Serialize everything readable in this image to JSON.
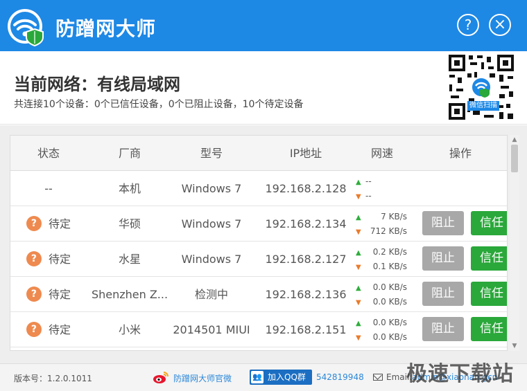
{
  "app": {
    "title": "防蹭网大师",
    "help_label": "?",
    "close_label": "×"
  },
  "header": {
    "network_title": "当前网络：有线局域网",
    "summary": "共连接10个设备：0个已信任设备，0个已阻止设备，10个待定设备",
    "qr_caption": "微信扫描"
  },
  "table": {
    "columns": [
      "状态",
      "厂商",
      "型号",
      "IP地址",
      "网速",
      "操作"
    ],
    "rows": [
      {
        "status": "--",
        "vendor": "本机",
        "model": "Windows 7",
        "ip": "192.168.2.128",
        "up": "--",
        "down": "--",
        "has_actions": false
      },
      {
        "status": "待定",
        "vendor": "华硕",
        "model": "Windows 7",
        "ip": "192.168.2.134",
        "up": "7 KB/s",
        "down": "712 KB/s",
        "has_actions": true
      },
      {
        "status": "待定",
        "vendor": "水星",
        "model": "Windows 7",
        "ip": "192.168.2.127",
        "up": "0.2 KB/s",
        "down": "0.1 KB/s",
        "has_actions": true
      },
      {
        "status": "待定",
        "vendor": "Shenzhen Z...",
        "model": "检测中",
        "ip": "192.168.2.136",
        "up": "0.0 KB/s",
        "down": "0.0 KB/s",
        "has_actions": true
      },
      {
        "status": "待定",
        "vendor": "小米",
        "model": "2014501 MIUI",
        "ip": "192.168.2.151",
        "up": "0.0 KB/s",
        "down": "0.0 KB/s",
        "has_actions": true
      }
    ],
    "block_label": "阻止",
    "trust_label": "信任",
    "status_icon": "exclamation-icon",
    "status_icon_glyph": "?"
  },
  "footer": {
    "version": "版本号：1.2.0.1011",
    "weibo_link": "防蹭网大师官微",
    "qq_button": "加入QQ群",
    "qq_number": "542819948",
    "email_label": "Email:",
    "email_value": "admin@xiaonan.gcn"
  },
  "watermark": "极速下载站",
  "colors": {
    "titlebar": "#1e88e5",
    "trust_green": "#2aa83a",
    "block_gray": "#a8a8a8",
    "pending_orange": "#ee8a4f",
    "link_blue": "#2c88d9"
  }
}
